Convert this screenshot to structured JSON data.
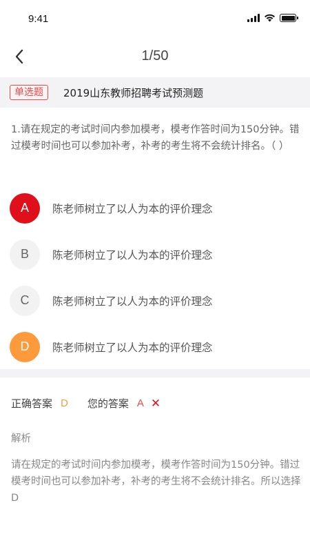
{
  "status_bar": {
    "time": "9:41",
    "icons": [
      "signal-icon",
      "wifi-icon",
      "battery-icon"
    ]
  },
  "nav": {
    "back_icon": "chevron-left-icon",
    "title": "1/50"
  },
  "header": {
    "badge": "单选题",
    "exam_title": "2019山东教师招聘考试预测题"
  },
  "question": {
    "text": "1.请在规定的考试时间内参加模考，模考作答时间为150分钟。错过模考时间也可以参加补考，补考的考生将不会统计排名。（ ）"
  },
  "options": [
    {
      "letter": "A",
      "text": "陈老师树立了以人为本的评价理念",
      "state": "user-selected"
    },
    {
      "letter": "B",
      "text": "陈老师树立了以人为本的评价理念",
      "state": "normal"
    },
    {
      "letter": "C",
      "text": "陈老师树立了以人为本的评价理念",
      "state": "normal"
    },
    {
      "letter": "D",
      "text": "陈老师树立了以人为本的评价理念",
      "state": "correct"
    }
  ],
  "result": {
    "correct_label": "正确答案",
    "correct_value": "D",
    "user_label": "您的答案",
    "user_value": "A",
    "wrong_mark": "✕"
  },
  "analysis": {
    "title": "解析",
    "text": "请在规定的考试时间内参加模考，模考作答时间为150分钟。错过模考时间也可以参加补考，补考的考生将不会统计排名。所以选择D"
  },
  "colors": {
    "accent_red": "#e0101a",
    "accent_orange": "#ff9a3c",
    "badge_red": "#e64b4b",
    "section_bg": "#f3f3f5"
  }
}
